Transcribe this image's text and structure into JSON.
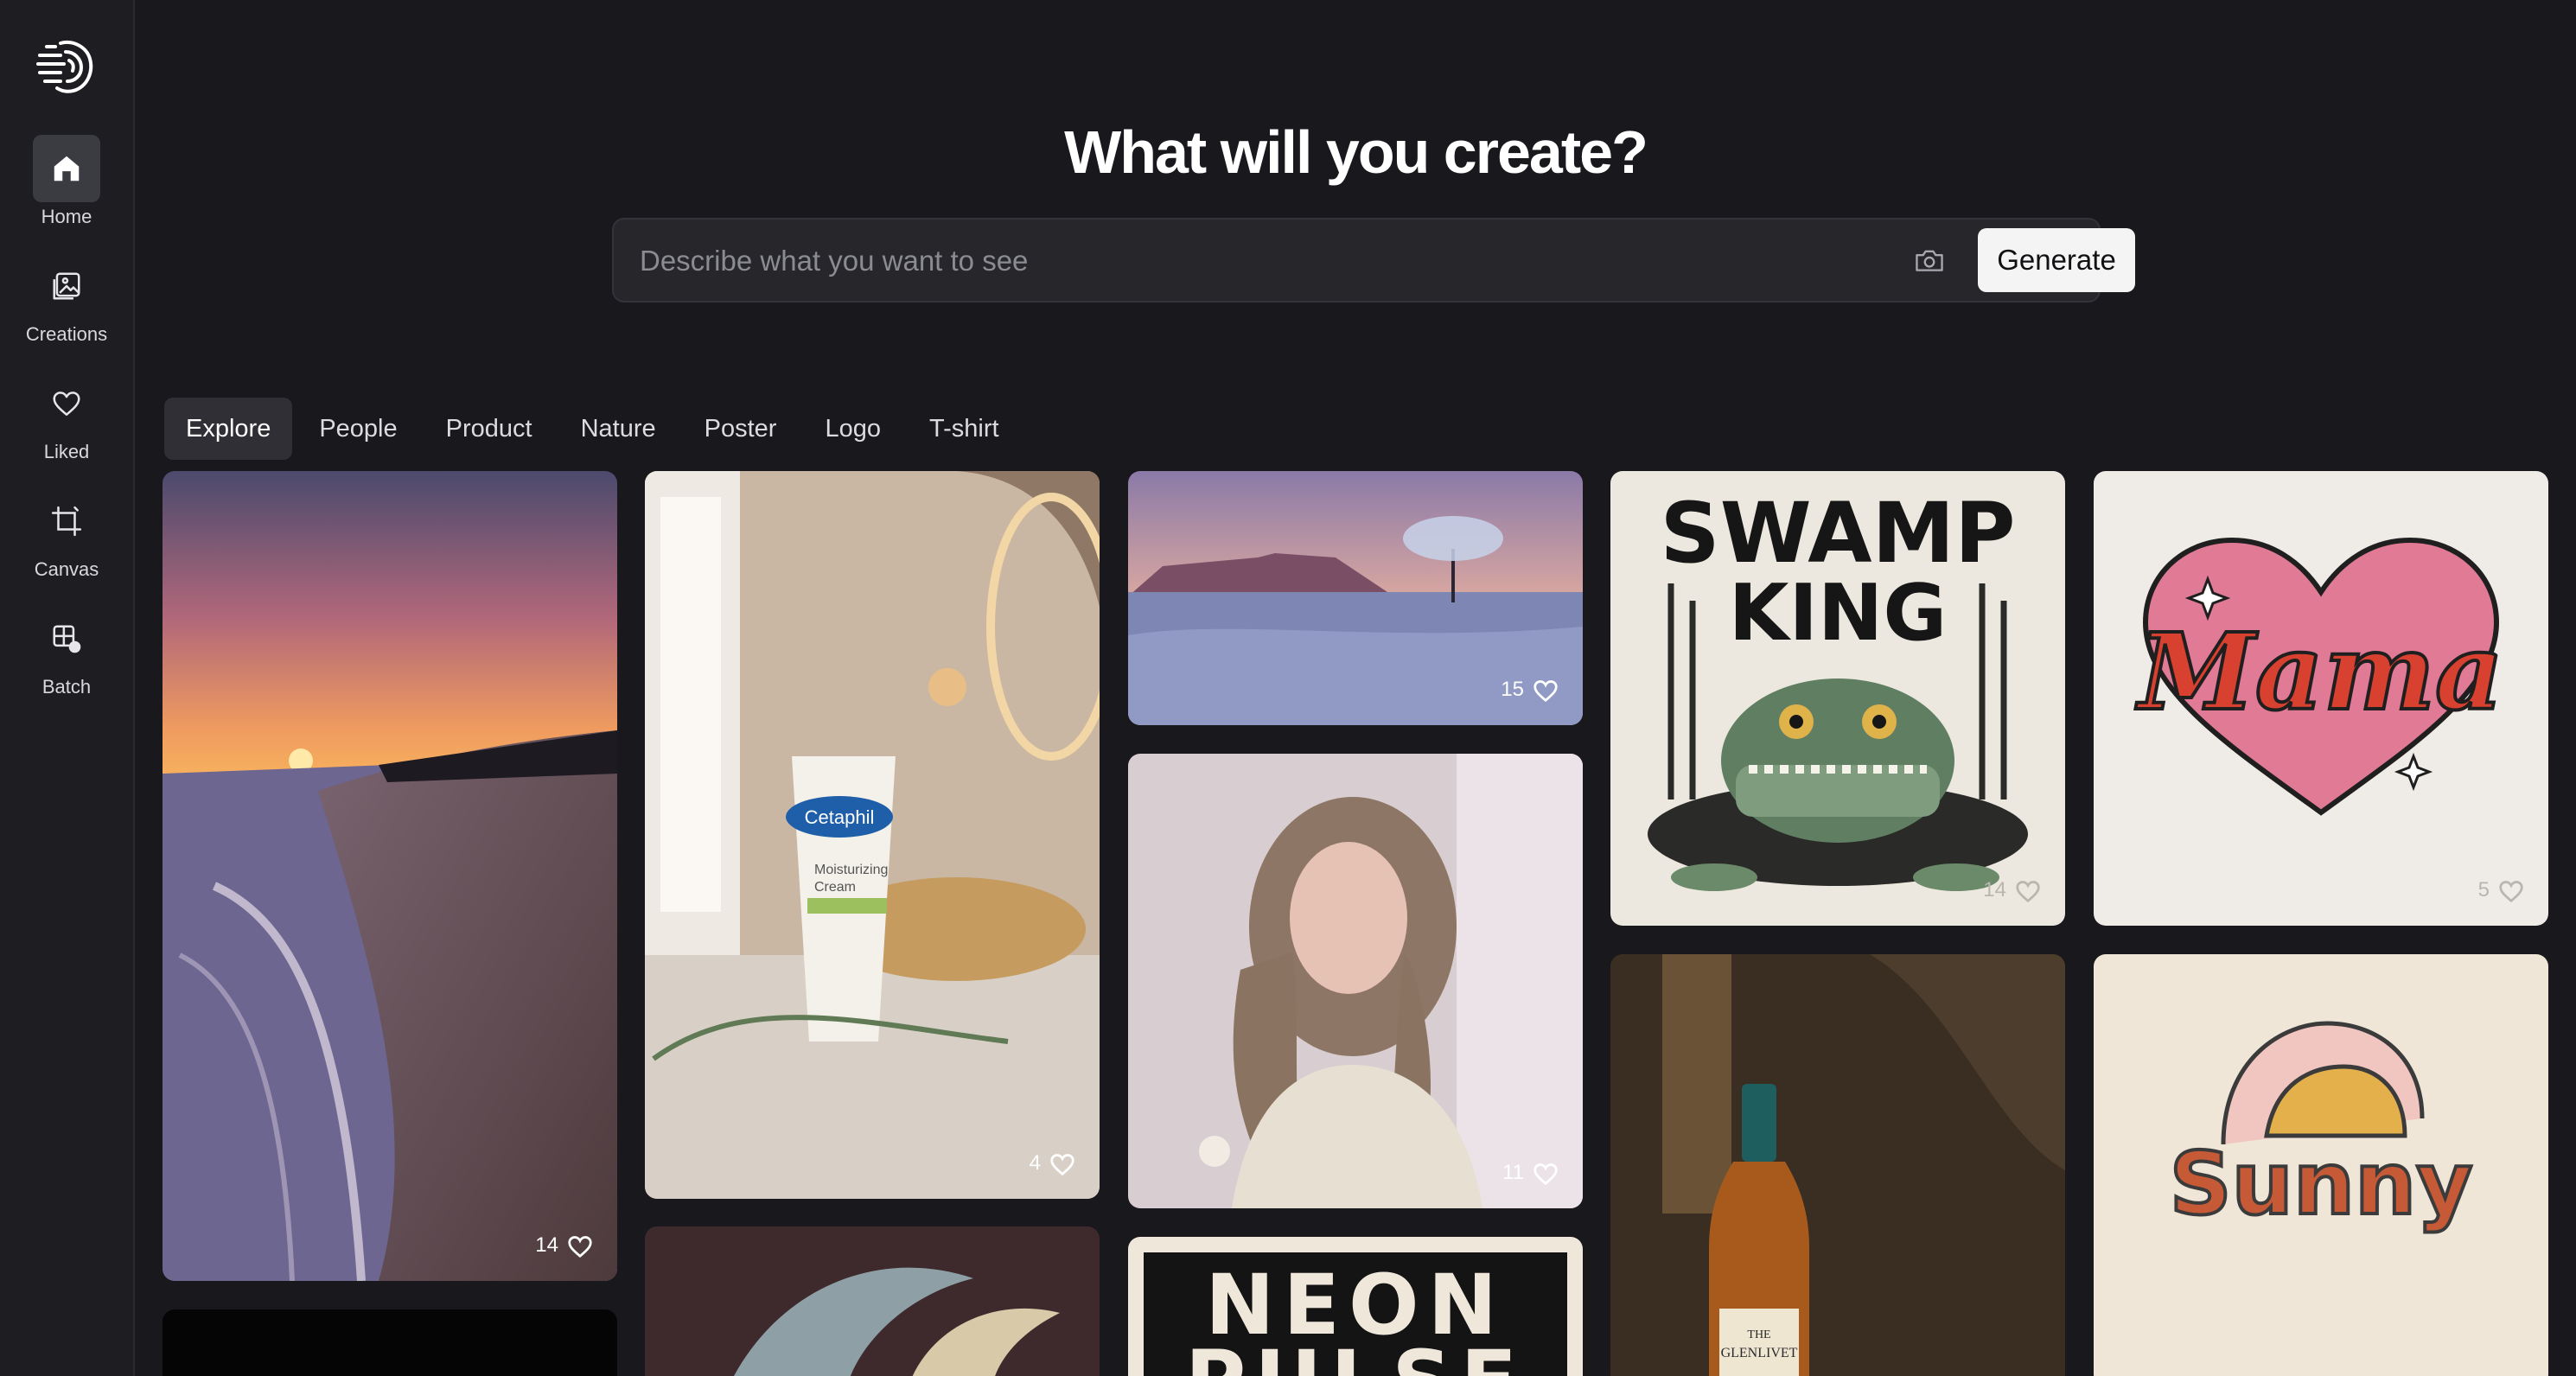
{
  "sidebar": {
    "items": [
      {
        "label": "Home",
        "icon": "home-icon"
      },
      {
        "label": "Creations",
        "icon": "image-icon"
      },
      {
        "label": "Liked",
        "icon": "heart-icon"
      },
      {
        "label": "Canvas",
        "icon": "crop-icon"
      },
      {
        "label": "Batch",
        "icon": "grid-icon"
      }
    ]
  },
  "hero": {
    "title": "What will you create?",
    "search_placeholder": "Describe what you want to see",
    "generate_label": "Generate"
  },
  "tabs": [
    "Explore",
    "People",
    "Product",
    "Nature",
    "Poster",
    "Logo",
    "T-shirt"
  ],
  "gallery": {
    "likes": {
      "beach": "14",
      "cream": "4",
      "plain": "15",
      "portrait": "11",
      "swamp": "14",
      "mama": "5"
    },
    "artwork_text": {
      "cetaphil_brand": "Cetaphil",
      "cetaphil_line1": "Moisturizing",
      "cetaphil_line2": "Cream",
      "swamp_line1": "SWAMP",
      "swamp_line2": "KING",
      "mama": "Mama",
      "neon_line1": "NEON",
      "neon_line2": "PULSE",
      "glenlivet_line1": "THE",
      "glenlivet_line2": "GLENLIVET",
      "sunny": "Sunny"
    }
  },
  "colors": {
    "background": "#18181d",
    "sidebar": "#1d1d22",
    "accent_button": "#f4f4f5"
  }
}
